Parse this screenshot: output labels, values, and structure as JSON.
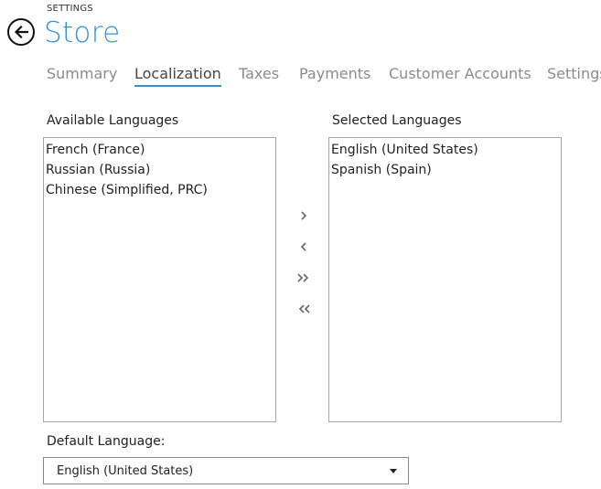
{
  "header": {
    "section": "SETTINGS",
    "title": "Store"
  },
  "tabs": [
    {
      "label": "Summary",
      "active": false
    },
    {
      "label": "Localization",
      "active": true
    },
    {
      "label": "Taxes",
      "active": false
    },
    {
      "label": "Payments",
      "active": false
    },
    {
      "label": "Customer Accounts",
      "active": false
    },
    {
      "label": "Settings",
      "active": false
    }
  ],
  "available": {
    "label": "Available Languages",
    "items": [
      "French (France)",
      "Russian (Russia)",
      "Chinese (Simplified, PRC)"
    ]
  },
  "selected": {
    "label": "Selected Languages",
    "items": [
      "English (United States)",
      "Spanish (Spain)"
    ]
  },
  "move_buttons": {
    "add": "chevron-right-icon",
    "remove": "chevron-left-icon",
    "add_all": "double-chevron-right-icon",
    "remove_all": "double-chevron-left-icon"
  },
  "default_language": {
    "label": "Default Language:",
    "value": "English (United States)"
  },
  "colors": {
    "accent": "#3b8ed4",
    "inactive_tab": "#8b8b8b"
  }
}
